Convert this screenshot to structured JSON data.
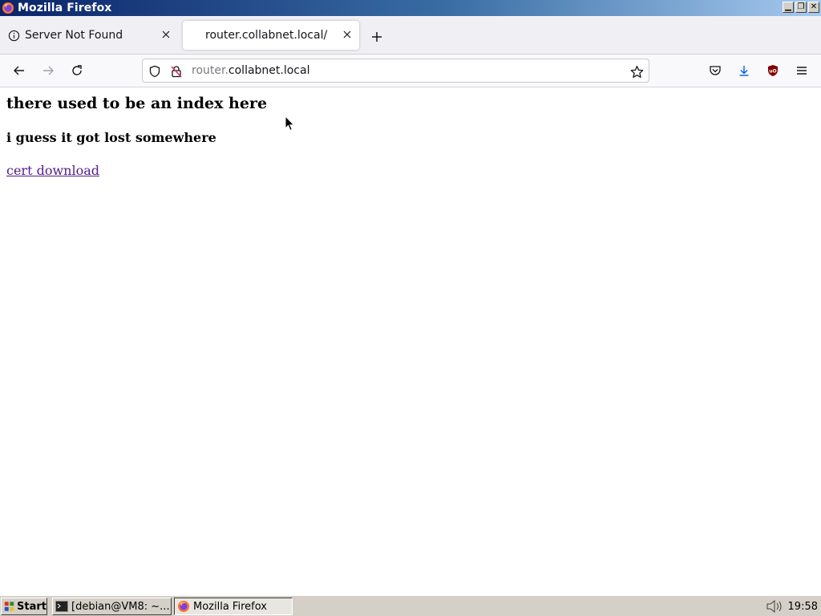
{
  "window": {
    "title": "Mozilla Firefox",
    "buttons": [
      "minimize",
      "maximize",
      "close"
    ]
  },
  "tabs": [
    {
      "label": "Server Not Found",
      "icon": "info-icon",
      "active": false
    },
    {
      "label": "router.collabnet.local/",
      "icon": "none",
      "active": true
    }
  ],
  "navbar": {
    "url_prefix": "router.",
    "url_domain": "collabnet.local"
  },
  "page": {
    "heading1": "there used to be an index here",
    "heading2": "i guess it got lost somewhere",
    "link_text": "cert download",
    "link_color": "#551a8b"
  },
  "taskbar": {
    "start_label": "Start",
    "tasks": [
      {
        "label": "[debian@VM8: ~...",
        "icon": "terminal-icon",
        "active": false
      },
      {
        "label": "Mozilla Firefox",
        "icon": "firefox-icon",
        "active": true
      }
    ],
    "clock": "19:58"
  }
}
